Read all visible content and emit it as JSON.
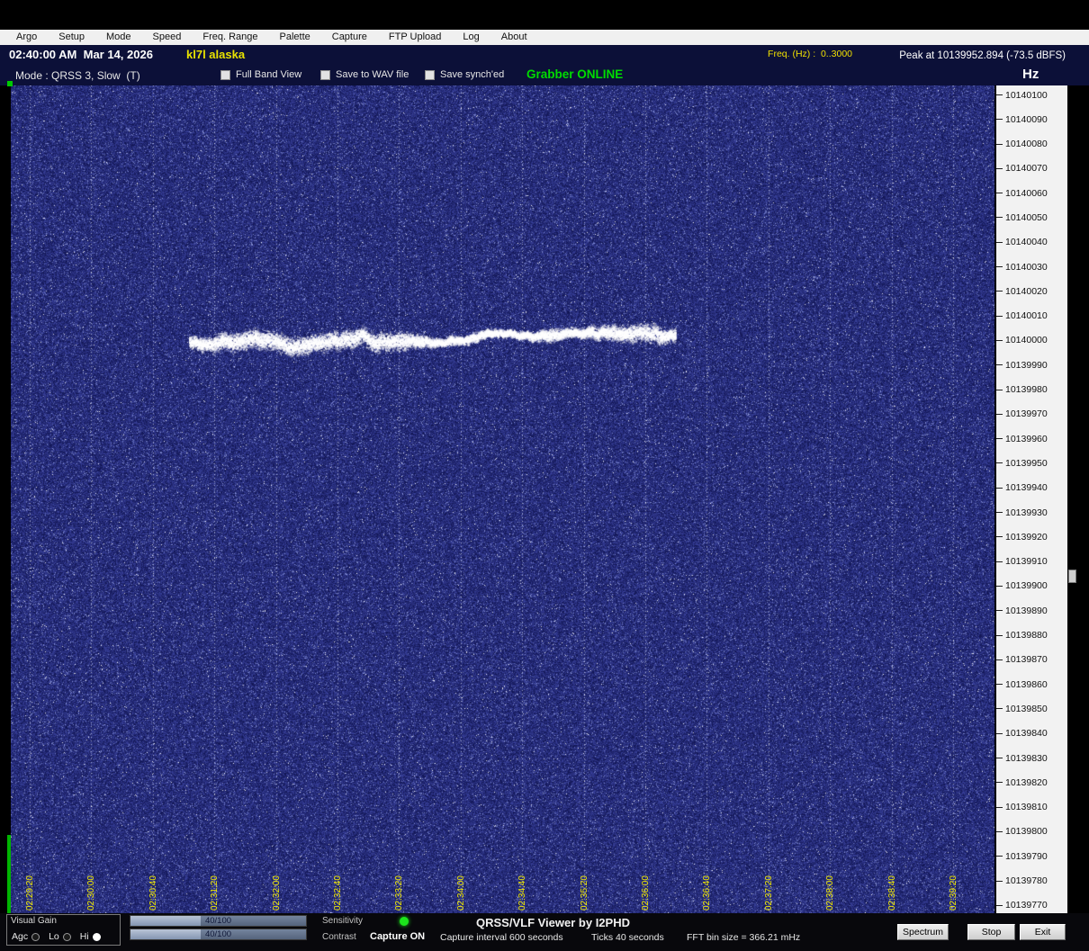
{
  "menu": {
    "items": [
      "Argo",
      "Setup",
      "Mode",
      "Speed",
      "Freq. Range",
      "Palette",
      "Capture",
      "FTP Upload",
      "Log",
      "About"
    ]
  },
  "header": {
    "timestamp": "02:40:00 AM  Mar 14, 2026",
    "station": "kl7l alaska",
    "freq_range_label": "Freq. (Hz) :  0..3000",
    "peak_readout": "Peak at 10139952.894 (-73.5 dBFS)"
  },
  "toolbar": {
    "mode_label": "Mode : QRSS 3, Slow  (T)",
    "checkboxes": [
      {
        "label": "Full Band View",
        "checked": false
      },
      {
        "label": "Save to WAV file",
        "checked": false
      },
      {
        "label": "Save synch'ed",
        "checked": false
      }
    ],
    "grabber_status": "Grabber ONLINE",
    "unit_label": "Hz"
  },
  "spectrogram": {
    "background_color": "#1b2066",
    "grid_color": "#ffffff",
    "time_label_color": "#f2ea00",
    "signal_color": "#ffffff",
    "signal_center_freq_hz": 10140000,
    "time_labels": [
      "02:29:20",
      "02:30:00",
      "02:30:40",
      "02:31:20",
      "02:32:00",
      "02:32:40",
      "02:33:20",
      "02:34:00",
      "02:34:40",
      "02:35:20",
      "02:36:00",
      "02:36:40",
      "02:37:20",
      "02:38:00",
      "02:38:40",
      "02:39:20"
    ]
  },
  "freq_scale": {
    "labels": [
      "10140100",
      "10140090",
      "10140080",
      "10140070",
      "10140060",
      "10140050",
      "10140040",
      "10140030",
      "10140020",
      "10140010",
      "10140000",
      "10139990",
      "10139980",
      "10139970",
      "10139960",
      "10139950",
      "10139940",
      "10139930",
      "10139920",
      "10139910",
      "10139900",
      "10139890",
      "10139880",
      "10139870",
      "10139860",
      "10139850",
      "10139840",
      "10139830",
      "10139820",
      "10139810",
      "10139800",
      "10139790",
      "10139780",
      "10139770"
    ]
  },
  "statusbar": {
    "visual_gain_label": "Visual Gain",
    "radios": [
      {
        "label": "Agc",
        "selected": false
      },
      {
        "label": "Lo",
        "selected": false
      },
      {
        "label": "Hi",
        "selected": true
      }
    ],
    "sliders": [
      {
        "value": "40/100",
        "pct": 40
      },
      {
        "value": "40/100",
        "pct": 40
      }
    ],
    "sensitivity_label": "Sensitivity",
    "contrast_label": "Contrast",
    "capture_status": "Capture ON",
    "capture_interval": "Capture interval 600 seconds",
    "app_title": "QRSS/VLF Viewer by I2PHD",
    "ticks_info": "Ticks  40 seconds",
    "fft_info": "FFT bin size = 366.21 mHz",
    "spectrum_button": "Spectrum",
    "stop_button": "Stop",
    "exit_button": "Exit"
  }
}
